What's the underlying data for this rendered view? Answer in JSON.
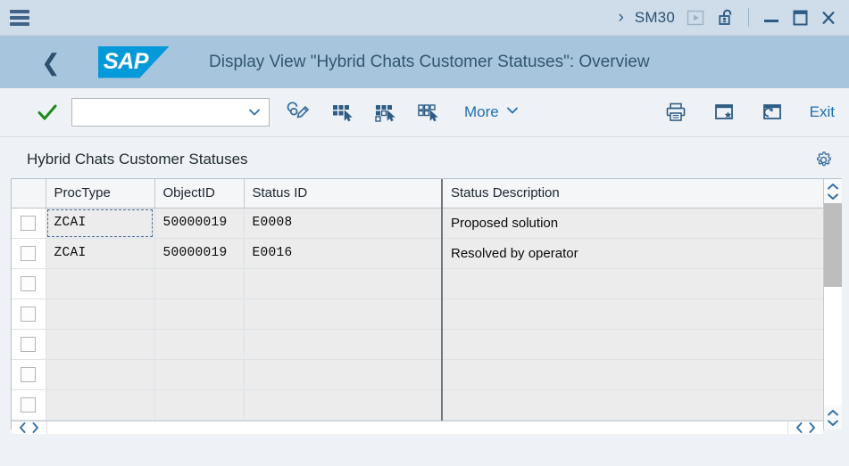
{
  "titlebar": {
    "menu_icon": "hamburger-icon",
    "chevron": "›",
    "transaction_code": "SM30",
    "play_icon": "play-button-icon",
    "lock_icon": "unlocked-padlock-icon",
    "minimize_icon": "minimize-icon",
    "maximize_icon": "maximize-icon",
    "close_icon": "close-icon",
    "background": "#cfdcea"
  },
  "header": {
    "back_icon": "back-chevron-icon",
    "logo_text": "SAP",
    "logo_color": "#049ada",
    "title": "Display View \"Hybrid Chats Customer Statuses\": Overview",
    "background": "#a8c5de"
  },
  "toolbar": {
    "confirm_icon": "green-checkmark-icon",
    "confirm_color": "#1a8a1a",
    "variant_value": "",
    "variant_placeholder": "",
    "dropdown_icon": "chevron-down-icon",
    "icons": [
      {
        "name": "edit-pencil-icon",
        "label": "Change"
      },
      {
        "name": "select-all-grid-icon",
        "label": "Select All"
      },
      {
        "name": "select-block-grid-icon",
        "label": "Select Block"
      },
      {
        "name": "deselect-all-grid-icon",
        "label": "Deselect All"
      }
    ],
    "more_label": "More",
    "more_icon": "chevron-down-icon",
    "right_icons": [
      {
        "name": "print-icon",
        "label": "Print"
      },
      {
        "name": "add-to-favorites-icon",
        "label": "Add to Favorites"
      },
      {
        "name": "open-in-new-window-icon",
        "label": "Open in New Window"
      }
    ],
    "exit_label": "Exit",
    "link_color": "#1e6eb5"
  },
  "panel": {
    "title": "Hybrid Chats Customer Statuses",
    "settings_icon": "gear-icon"
  },
  "table": {
    "columns": [
      {
        "key": "select",
        "label": ""
      },
      {
        "key": "proctype",
        "label": "ProcType"
      },
      {
        "key": "objectid",
        "label": "ObjectID"
      },
      {
        "key": "statusid",
        "label": "Status ID"
      },
      {
        "key": "description",
        "label": "Status Description"
      }
    ],
    "rows": [
      {
        "proctype": "ZCAI",
        "objectid": "50000019",
        "statusid": "E0008",
        "description": "Proposed solution",
        "focused": true
      },
      {
        "proctype": "ZCAI",
        "objectid": "50000019",
        "statusid": "E0016",
        "description": "Resolved by operator",
        "focused": false
      },
      {
        "proctype": "",
        "objectid": "",
        "statusid": "",
        "description": "",
        "focused": false
      },
      {
        "proctype": "",
        "objectid": "",
        "statusid": "",
        "description": "",
        "focused": false
      },
      {
        "proctype": "",
        "objectid": "",
        "statusid": "",
        "description": "",
        "focused": false
      },
      {
        "proctype": "",
        "objectid": "",
        "statusid": "",
        "description": "",
        "focused": false
      },
      {
        "proctype": "",
        "objectid": "",
        "statusid": "",
        "description": "",
        "focused": false
      }
    ],
    "row_count": 7
  },
  "scrollbars": {
    "vertical": {
      "up_icon": "chevron-up-icon",
      "down_icon": "chevron-down-icon",
      "thumb_color": "#bdbdbd"
    },
    "horizontal": {
      "left_icon": "chevron-left-icon",
      "right_icon": "chevron-right-icon"
    }
  }
}
